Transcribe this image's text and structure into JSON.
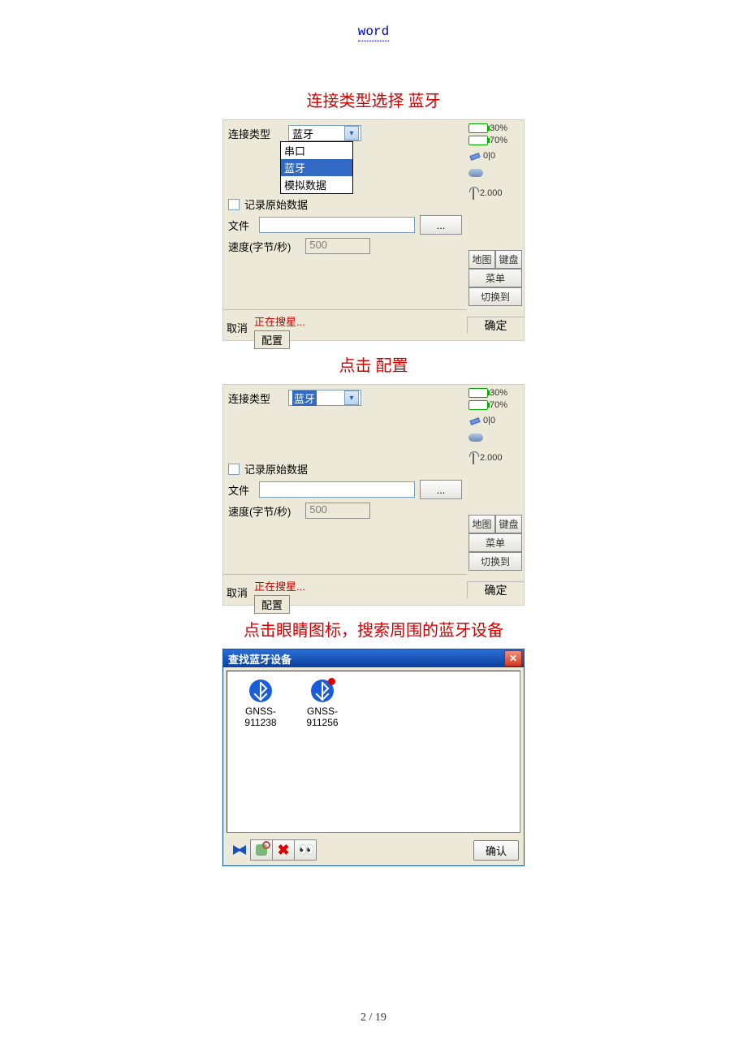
{
  "header": {
    "title": "word"
  },
  "captions": {
    "c1": "连接类型选择   蓝牙",
    "c2": "点击 配置",
    "c3": "点击眼睛图标，搜索周围的蓝牙设备"
  },
  "panel_a": {
    "conn_type_label": "连接类型",
    "conn_type_value": "蓝牙",
    "options": {
      "serial": "串口",
      "bt": "蓝牙",
      "sim": "模拟数据"
    },
    "record_raw": "记录原始数据",
    "file_label": "文件",
    "file_btn": "...",
    "speed_label": "速度(字节/秒)",
    "speed_value": "500",
    "cancel": "取消",
    "searching": "正在搜星...",
    "config_tab": "配置",
    "ok": "确定",
    "status": {
      "batt1": "30%",
      "batt2": "70%",
      "sat": "0|0",
      "ant": "2.000"
    },
    "side_btns": {
      "map": "地图",
      "kbd": "键盘",
      "menu": "菜单",
      "switch": "切换到"
    }
  },
  "panel_b": {
    "conn_type_label": "连接类型",
    "conn_type_value": "蓝牙",
    "record_raw": "记录原始数据",
    "file_label": "文件",
    "file_btn": "...",
    "speed_label": "速度(字节/秒)",
    "speed_value": "500",
    "cancel": "取消",
    "searching": "正在搜星...",
    "config_tab": "配置",
    "ok": "确定",
    "status": {
      "batt1": "30%",
      "batt2": "70%",
      "sat": "0|0",
      "ant": "2.000"
    },
    "side_btns": {
      "map": "地图",
      "kbd": "键盘",
      "menu": "菜单",
      "switch": "切换到"
    }
  },
  "bt_dialog": {
    "title": "查找蓝牙设备",
    "devices": [
      {
        "name_l1": "GNSS-",
        "name_l2": "911238",
        "dot": false
      },
      {
        "name_l1": "GNSS-",
        "name_l2": "911256",
        "dot": true
      }
    ],
    "confirm": "确认"
  },
  "page_number": "2  / 19"
}
